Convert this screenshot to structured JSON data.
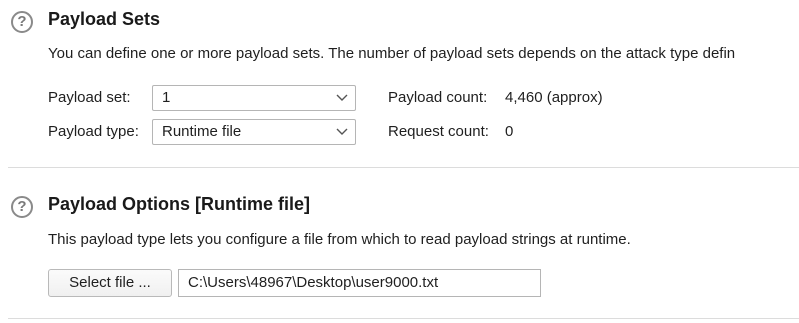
{
  "payload_sets": {
    "title": "Payload Sets",
    "help_glyph": "?",
    "description": "You can define one or more payload sets. The number of payload sets depends on the attack type defin",
    "payload_set_label": "Payload set:",
    "payload_set_value": "1",
    "payload_type_label": "Payload type:",
    "payload_type_value": "Runtime file",
    "payload_count_label": "Payload count:",
    "payload_count_value": "4,460 (approx)",
    "request_count_label": "Request count:",
    "request_count_value": "0"
  },
  "payload_options": {
    "title": "Payload Options [Runtime file]",
    "help_glyph": "?",
    "description": "This payload type lets you configure a file from which to read payload strings at runtime.",
    "select_file_label": "Select file ...",
    "file_path_value": "C:\\Users\\48967\\Desktop\\user9000.txt"
  },
  "icons": {
    "help": "question-circle-icon",
    "dropdown": "chevron-down-icon"
  }
}
